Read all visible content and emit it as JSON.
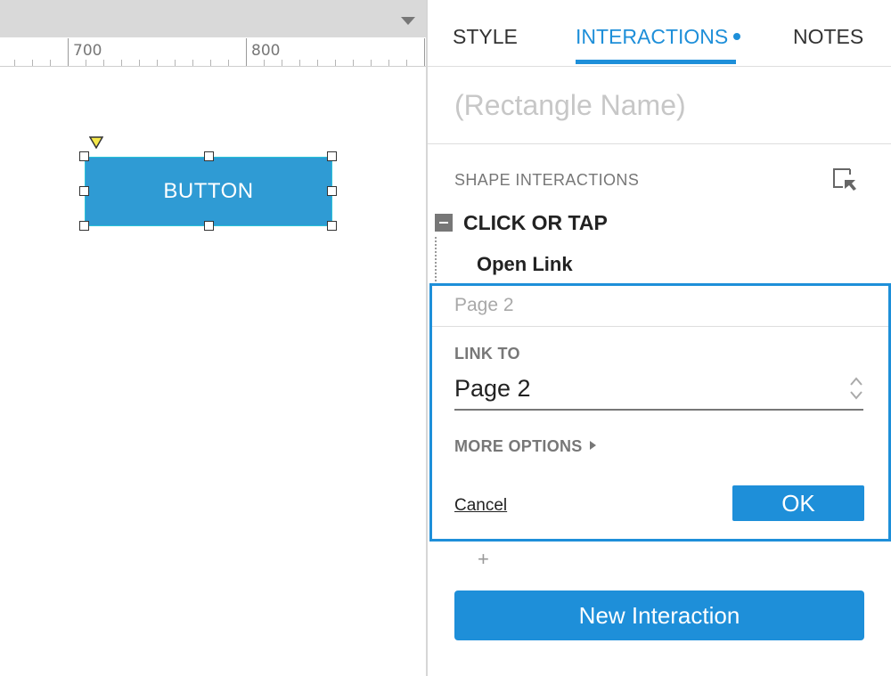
{
  "canvas": {
    "ruler": {
      "labels": [
        "700",
        "800"
      ]
    },
    "shape": {
      "label": "BUTTON",
      "fill_color": "#2f9bd4"
    }
  },
  "panel": {
    "tabs": [
      {
        "label": "STYLE",
        "active": false
      },
      {
        "label": "INTERACTIONS",
        "active": true,
        "has_indicator": true
      },
      {
        "label": "NOTES",
        "active": false
      }
    ],
    "shape_name_placeholder": "(Rectangle Name)",
    "section_title": "SHAPE INTERACTIONS",
    "interaction": {
      "trigger": "CLICK OR TAP",
      "action": "Open Link",
      "editor": {
        "input_value": "Page 2",
        "link_to_label": "LINK TO",
        "link_to_value": "Page 2",
        "more_options_label": "MORE OPTIONS",
        "cancel_label": "Cancel",
        "ok_label": "OK"
      }
    },
    "add_symbol": "+",
    "new_interaction_label": "New Interaction"
  },
  "colors": {
    "accent": "#1e8fd9",
    "shape_fill": "#2f9bd4",
    "selection_marker": "#f5e84a"
  },
  "icons": [
    "dropdown-triangle-icon",
    "selection-area-icon",
    "collapse-minus-icon",
    "chevron-up-down-icon",
    "disclosure-triangle-icon",
    "plus-icon"
  ]
}
